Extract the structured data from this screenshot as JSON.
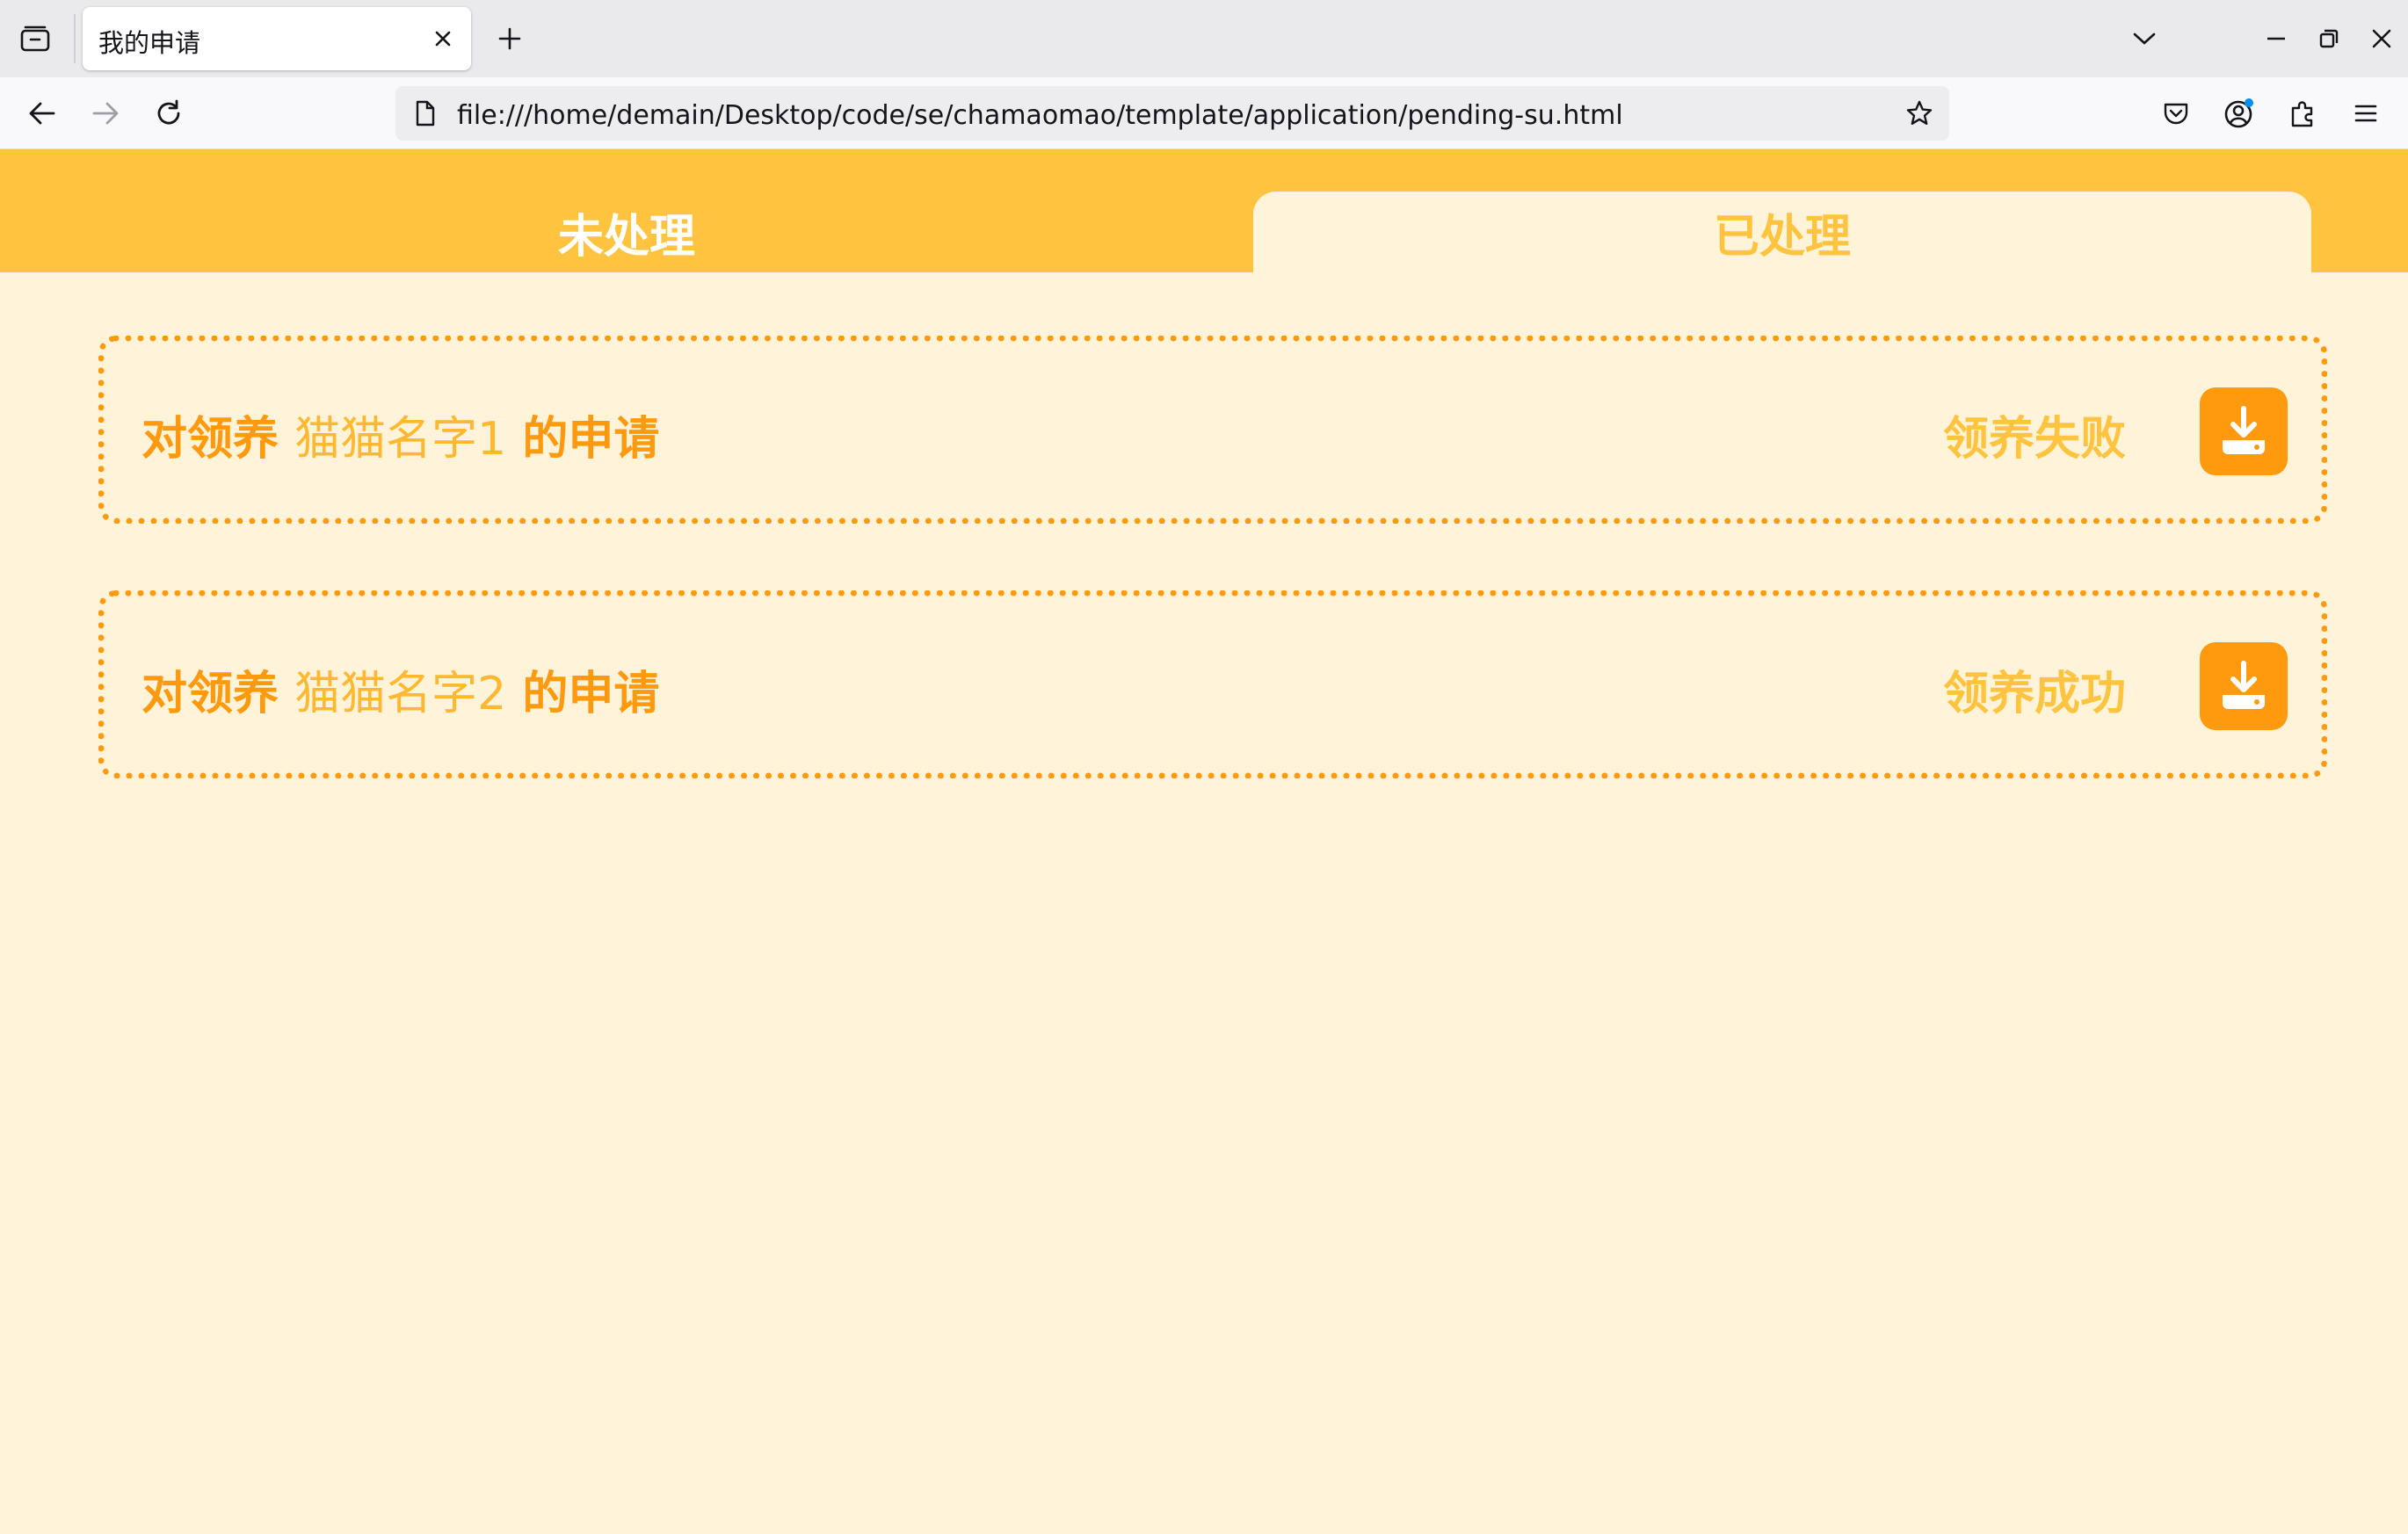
{
  "browser": {
    "tab_title": "我的申请",
    "url": "file:///home/demain/Desktop/code/se/chamaomao/template/application/pending-su.html"
  },
  "page": {
    "tabs": [
      {
        "label": "未处理",
        "active": false
      },
      {
        "label": "已处理",
        "active": true
      }
    ],
    "applications": [
      {
        "prefix": "对领养",
        "cat_name": "猫猫名字1",
        "suffix": "的申请",
        "status": "领养失败"
      },
      {
        "prefix": "对领养",
        "cat_name": "猫猫名字2",
        "suffix": "的申请",
        "status": "领养成功"
      }
    ]
  },
  "colors": {
    "header": "#FFC43F",
    "background": "#FFF3D9",
    "accent": "#FF9A0E",
    "cat_name": "#FFB830"
  }
}
